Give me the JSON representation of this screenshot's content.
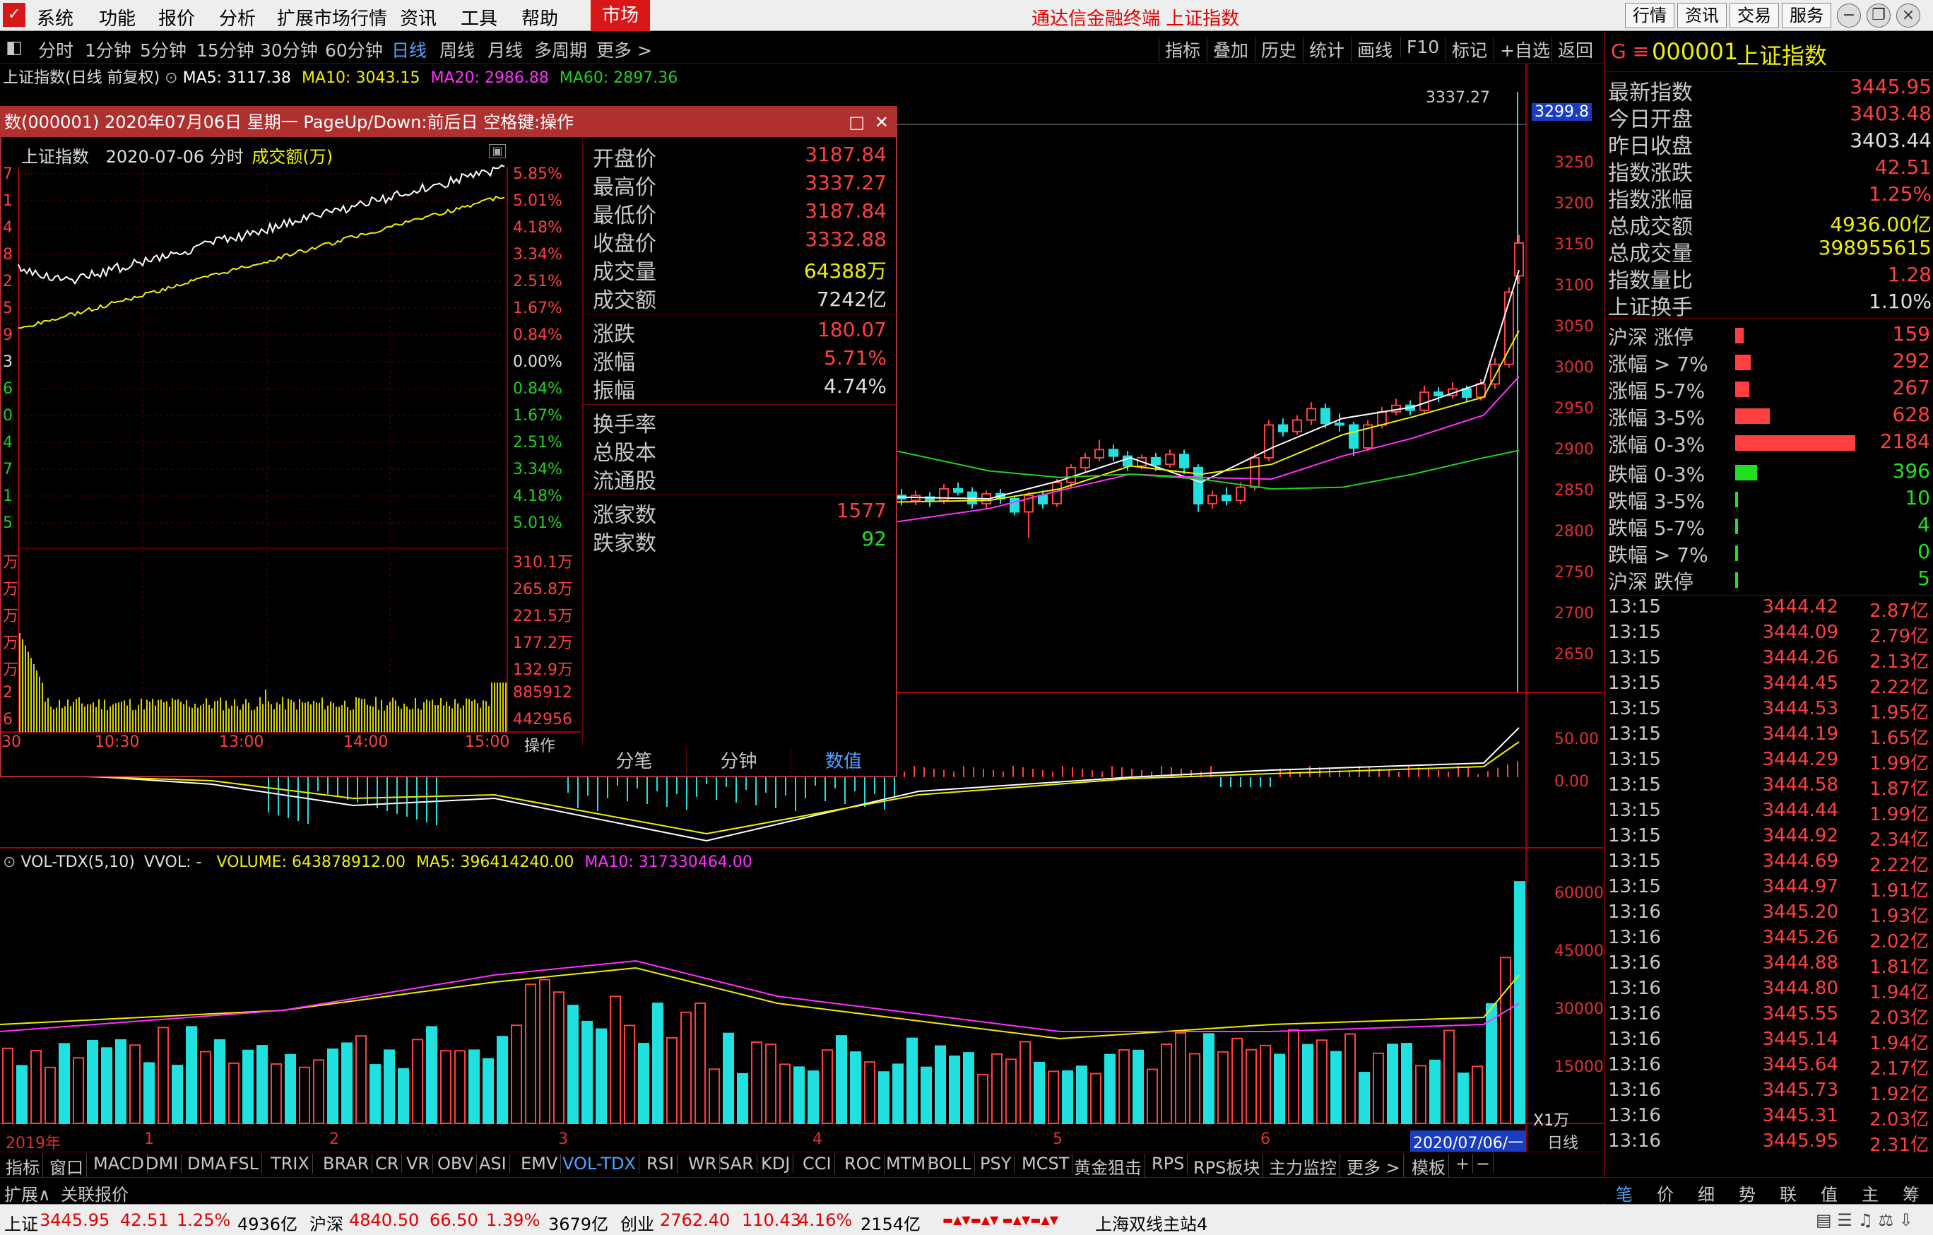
{
  "menubar": {
    "items": [
      "系统",
      "功能",
      "报价",
      "分析",
      "扩展市场行情",
      "资讯",
      "工具",
      "帮助"
    ],
    "market": "市场",
    "title": "通达信金融终端 上证指数",
    "right_buttons": [
      "行情",
      "资讯",
      "交易",
      "服务"
    ]
  },
  "toolbar": {
    "periods": [
      "分时",
      "1分钟",
      "5分钟",
      "15分钟",
      "30分钟",
      "60分钟",
      "日线",
      "周线",
      "月线",
      "多周期",
      "更多 >"
    ],
    "active_period": "日线",
    "right_tools": [
      "指标",
      "叠加",
      "历史",
      "统计",
      "画线",
      "F10",
      "标记",
      "+自选",
      "返回"
    ]
  },
  "main_legend": {
    "title": "上证指数(日线 前复权)",
    "ma5": "MA5: 3117.38",
    "ma10": "MA10: 3043.15",
    "ma20": "MA20: 2986.88",
    "ma60": "MA60: 2897.36"
  },
  "price_axis": {
    "labels": [
      "3250",
      "3200",
      "3150",
      "3100",
      "3050",
      "3000",
      "2950",
      "2900",
      "2850",
      "2800",
      "2750",
      "2700",
      "2650"
    ],
    "current_price": "3299.8",
    "high_marker": "3337.27"
  },
  "macd_axis": [
    "50.00",
    "0.00"
  ],
  "vol_legend": {
    "name": "VOL-TDX(5,10)",
    "vvol": "VVOL: -",
    "volume": "VOLUME: 643878912.00",
    "ma5": "MA5: 396414240.00",
    "ma10": "MA10: 317330464.00"
  },
  "vol_axis": [
    "60000",
    "45000",
    "30000",
    "15000"
  ],
  "vol_unit": "X1万",
  "time_axis": {
    "labels": [
      "2019年",
      "1",
      "2",
      "3",
      "4",
      "5",
      "6"
    ],
    "current": "2020/07/06/一"
  },
  "period_label": "日线",
  "popup": {
    "title": "数(000001) 2020年07月06日 星期一 PageUp/Down:前后日 空格键:操作",
    "intraday_title": "上证指数",
    "intraday_date": "2020-07-06 分时",
    "intraday_metric": "成交额(万)",
    "pct_labels": [
      "5.85%",
      "5.01%",
      "4.18%",
      "3.34%",
      "2.51%",
      "1.67%",
      "0.84%",
      "0.00%",
      "0.84%",
      "1.67%",
      "2.51%",
      "3.34%",
      "4.18%",
      "5.01%"
    ],
    "left_labels": [
      "7",
      "1",
      "4",
      "8",
      "2",
      "5",
      "9",
      "3",
      "6",
      "0",
      "4",
      "7",
      "1",
      "5"
    ],
    "amt_labels": [
      "310.1万",
      "265.8万",
      "221.5万",
      "177.2万",
      "132.9万",
      "885912",
      "442956"
    ],
    "left_amt_labels": [
      "万",
      "万",
      "万",
      "万",
      "万",
      "2",
      "6"
    ],
    "time_labels": [
      "30",
      "10:30",
      "13:00",
      "14:00",
      "15:00"
    ],
    "op_label": "操作",
    "info": [
      {
        "label": "开盘价",
        "value": "3187.84",
        "color": "#ff4040"
      },
      {
        "label": "最高价",
        "value": "3337.27",
        "color": "#ff4040"
      },
      {
        "label": "最低价",
        "value": "3187.84",
        "color": "#ff4040"
      },
      {
        "label": "收盘价",
        "value": "3332.88",
        "color": "#ff4040"
      },
      {
        "label": "成交量",
        "value": "64388万",
        "color": "#f0f000"
      },
      {
        "label": "成交额",
        "value": "7242亿",
        "color": "#e0e0e0"
      }
    ],
    "info2": [
      {
        "label": "涨跌",
        "value": "180.07",
        "color": "#ff4040"
      },
      {
        "label": "涨幅",
        "value": "5.71%",
        "color": "#ff4040"
      },
      {
        "label": "振幅",
        "value": "4.74%",
        "color": "#e0e0e0"
      }
    ],
    "info3": [
      {
        "label": "换手率",
        "value": "",
        "color": "#e0e0e0"
      },
      {
        "label": "总股本",
        "value": "",
        "color": "#e0e0e0"
      },
      {
        "label": "流通股",
        "value": "",
        "color": "#e0e0e0"
      }
    ],
    "info4": [
      {
        "label": "涨家数",
        "value": "1577",
        "color": "#ff4040"
      },
      {
        "label": "跌家数",
        "value": "92",
        "color": "#20e020"
      }
    ],
    "tabs": [
      "分笔",
      "分钟",
      "数值"
    ],
    "active_tab": "数值"
  },
  "rightpanel": {
    "code": "000001",
    "name": "上证指数",
    "stats": [
      {
        "label": "最新指数",
        "value": "3445.95",
        "color": "#ff4040"
      },
      {
        "label": "今日开盘",
        "value": "3403.48",
        "color": "#ff4040"
      },
      {
        "label": "昨日收盘",
        "value": "3403.44",
        "color": "#e0e0e0"
      },
      {
        "label": "指数涨跌",
        "value": "42.51",
        "color": "#ff4040"
      },
      {
        "label": "指数涨幅",
        "value": "1.25%",
        "color": "#ff4040"
      },
      {
        "label": "总成交额",
        "value": "4936.00亿",
        "color": "#f0f000"
      },
      {
        "label": "总成交量",
        "value": "398955615",
        "color": "#f0f000"
      },
      {
        "label": "指数量比",
        "value": "1.28",
        "color": "#ff4040"
      },
      {
        "label": "上证换手",
        "value": "1.10%",
        "color": "#e0e0e0"
      }
    ],
    "breadth": [
      {
        "label": "沪深 涨停",
        "value": "159",
        "bar": 0.07,
        "color": "#ff4040"
      },
      {
        "label": "涨幅 > 7%",
        "value": "292",
        "bar": 0.13,
        "color": "#ff4040"
      },
      {
        "label": "涨幅 5-7%",
        "value": "267",
        "bar": 0.12,
        "color": "#ff4040"
      },
      {
        "label": "涨幅 3-5%",
        "value": "628",
        "bar": 0.29,
        "color": "#ff4040"
      },
      {
        "label": "涨幅 0-3%",
        "value": "2184",
        "bar": 1.0,
        "color": "#ff4040"
      },
      {
        "label": "跌幅 0-3%",
        "value": "396",
        "bar": 0.18,
        "color": "#20e020"
      },
      {
        "label": "跌幅 3-5%",
        "value": "10",
        "bar": 0.01,
        "color": "#20e020"
      },
      {
        "label": "跌幅 5-7%",
        "value": "4",
        "bar": 0.01,
        "color": "#20e020"
      },
      {
        "label": "跌幅 > 7%",
        "value": "0",
        "bar": 0.01,
        "color": "#20e020"
      },
      {
        "label": "沪深 跌停",
        "value": "5",
        "bar": 0.01,
        "color": "#20e020"
      }
    ],
    "ticks": [
      {
        "t": "13:15",
        "p": "3444.42",
        "a": "2.87亿"
      },
      {
        "t": "13:15",
        "p": "3444.09",
        "a": "2.79亿"
      },
      {
        "t": "13:15",
        "p": "3444.26",
        "a": "2.13亿"
      },
      {
        "t": "13:15",
        "p": "3444.45",
        "a": "2.22亿"
      },
      {
        "t": "13:15",
        "p": "3444.53",
        "a": "1.95亿"
      },
      {
        "t": "13:15",
        "p": "3444.19",
        "a": "1.65亿"
      },
      {
        "t": "13:15",
        "p": "3444.29",
        "a": "1.99亿"
      },
      {
        "t": "13:15",
        "p": "3444.58",
        "a": "1.87亿"
      },
      {
        "t": "13:15",
        "p": "3444.44",
        "a": "1.99亿"
      },
      {
        "t": "13:15",
        "p": "3444.92",
        "a": "2.34亿"
      },
      {
        "t": "13:15",
        "p": "3444.69",
        "a": "2.22亿"
      },
      {
        "t": "13:15",
        "p": "3444.97",
        "a": "1.91亿"
      },
      {
        "t": "13:16",
        "p": "3445.20",
        "a": "1.93亿"
      },
      {
        "t": "13:16",
        "p": "3445.26",
        "a": "2.02亿"
      },
      {
        "t": "13:16",
        "p": "3444.88",
        "a": "1.81亿"
      },
      {
        "t": "13:16",
        "p": "3444.80",
        "a": "1.94亿"
      },
      {
        "t": "13:16",
        "p": "3445.55",
        "a": "2.03亿"
      },
      {
        "t": "13:16",
        "p": "3445.14",
        "a": "1.94亿"
      },
      {
        "t": "13:16",
        "p": "3445.64",
        "a": "2.17亿"
      },
      {
        "t": "13:16",
        "p": "3445.73",
        "a": "1.92亿"
      },
      {
        "t": "13:16",
        "p": "3445.31",
        "a": "2.03亿"
      },
      {
        "t": "13:16",
        "p": "3445.95",
        "a": "2.31亿"
      }
    ],
    "bottom_tabs": [
      "笔",
      "价",
      "细",
      "势",
      "联",
      "值",
      "主",
      "筹"
    ]
  },
  "indicator_tabs": [
    "指标",
    "窗口",
    "MACD",
    "DMI",
    "DMA",
    "FSL",
    "TRIX",
    "BRAR",
    "CR",
    "VR",
    "OBV",
    "ASI",
    "EMV",
    "VOL-TDX",
    "RSI",
    "WR",
    "SAR",
    "KDJ",
    "CCI",
    "ROC",
    "MTM",
    "BOLL",
    "PSY",
    "MCST",
    "黄金狙击",
    "RPS",
    "RPS板块",
    "主力监控",
    "更多 >",
    "模板",
    "+",
    "−"
  ],
  "active_indicator": "VOL-TDX",
  "extbar": {
    "expand": "扩展∧",
    "quote": "关联报价"
  },
  "statusbar": {
    "sh_name": "上证",
    "sh_price": "3445.95",
    "sh_chg": "42.51",
    "sh_pct": "1.25%",
    "sh_amt": "4936亿",
    "hs_name": "沪深",
    "hs_price": "4840.50",
    "hs_chg": "66.50",
    "hs_pct": "1.39%",
    "hs_amt": "3679亿",
    "cy_name": "创业",
    "cy_price": "2762.40",
    "cy_chg": "110.43",
    "cy_pct": "4.16%",
    "cy_amt": "2154亿",
    "server": "上海双线主站4"
  },
  "colors": {
    "up": "#ff4040",
    "down": "#20e0e0",
    "ma5": "#ffffff",
    "ma10": "#f0f000",
    "ma20": "#ff30ff",
    "ma60": "#20d020",
    "axis": "#a00000"
  }
}
